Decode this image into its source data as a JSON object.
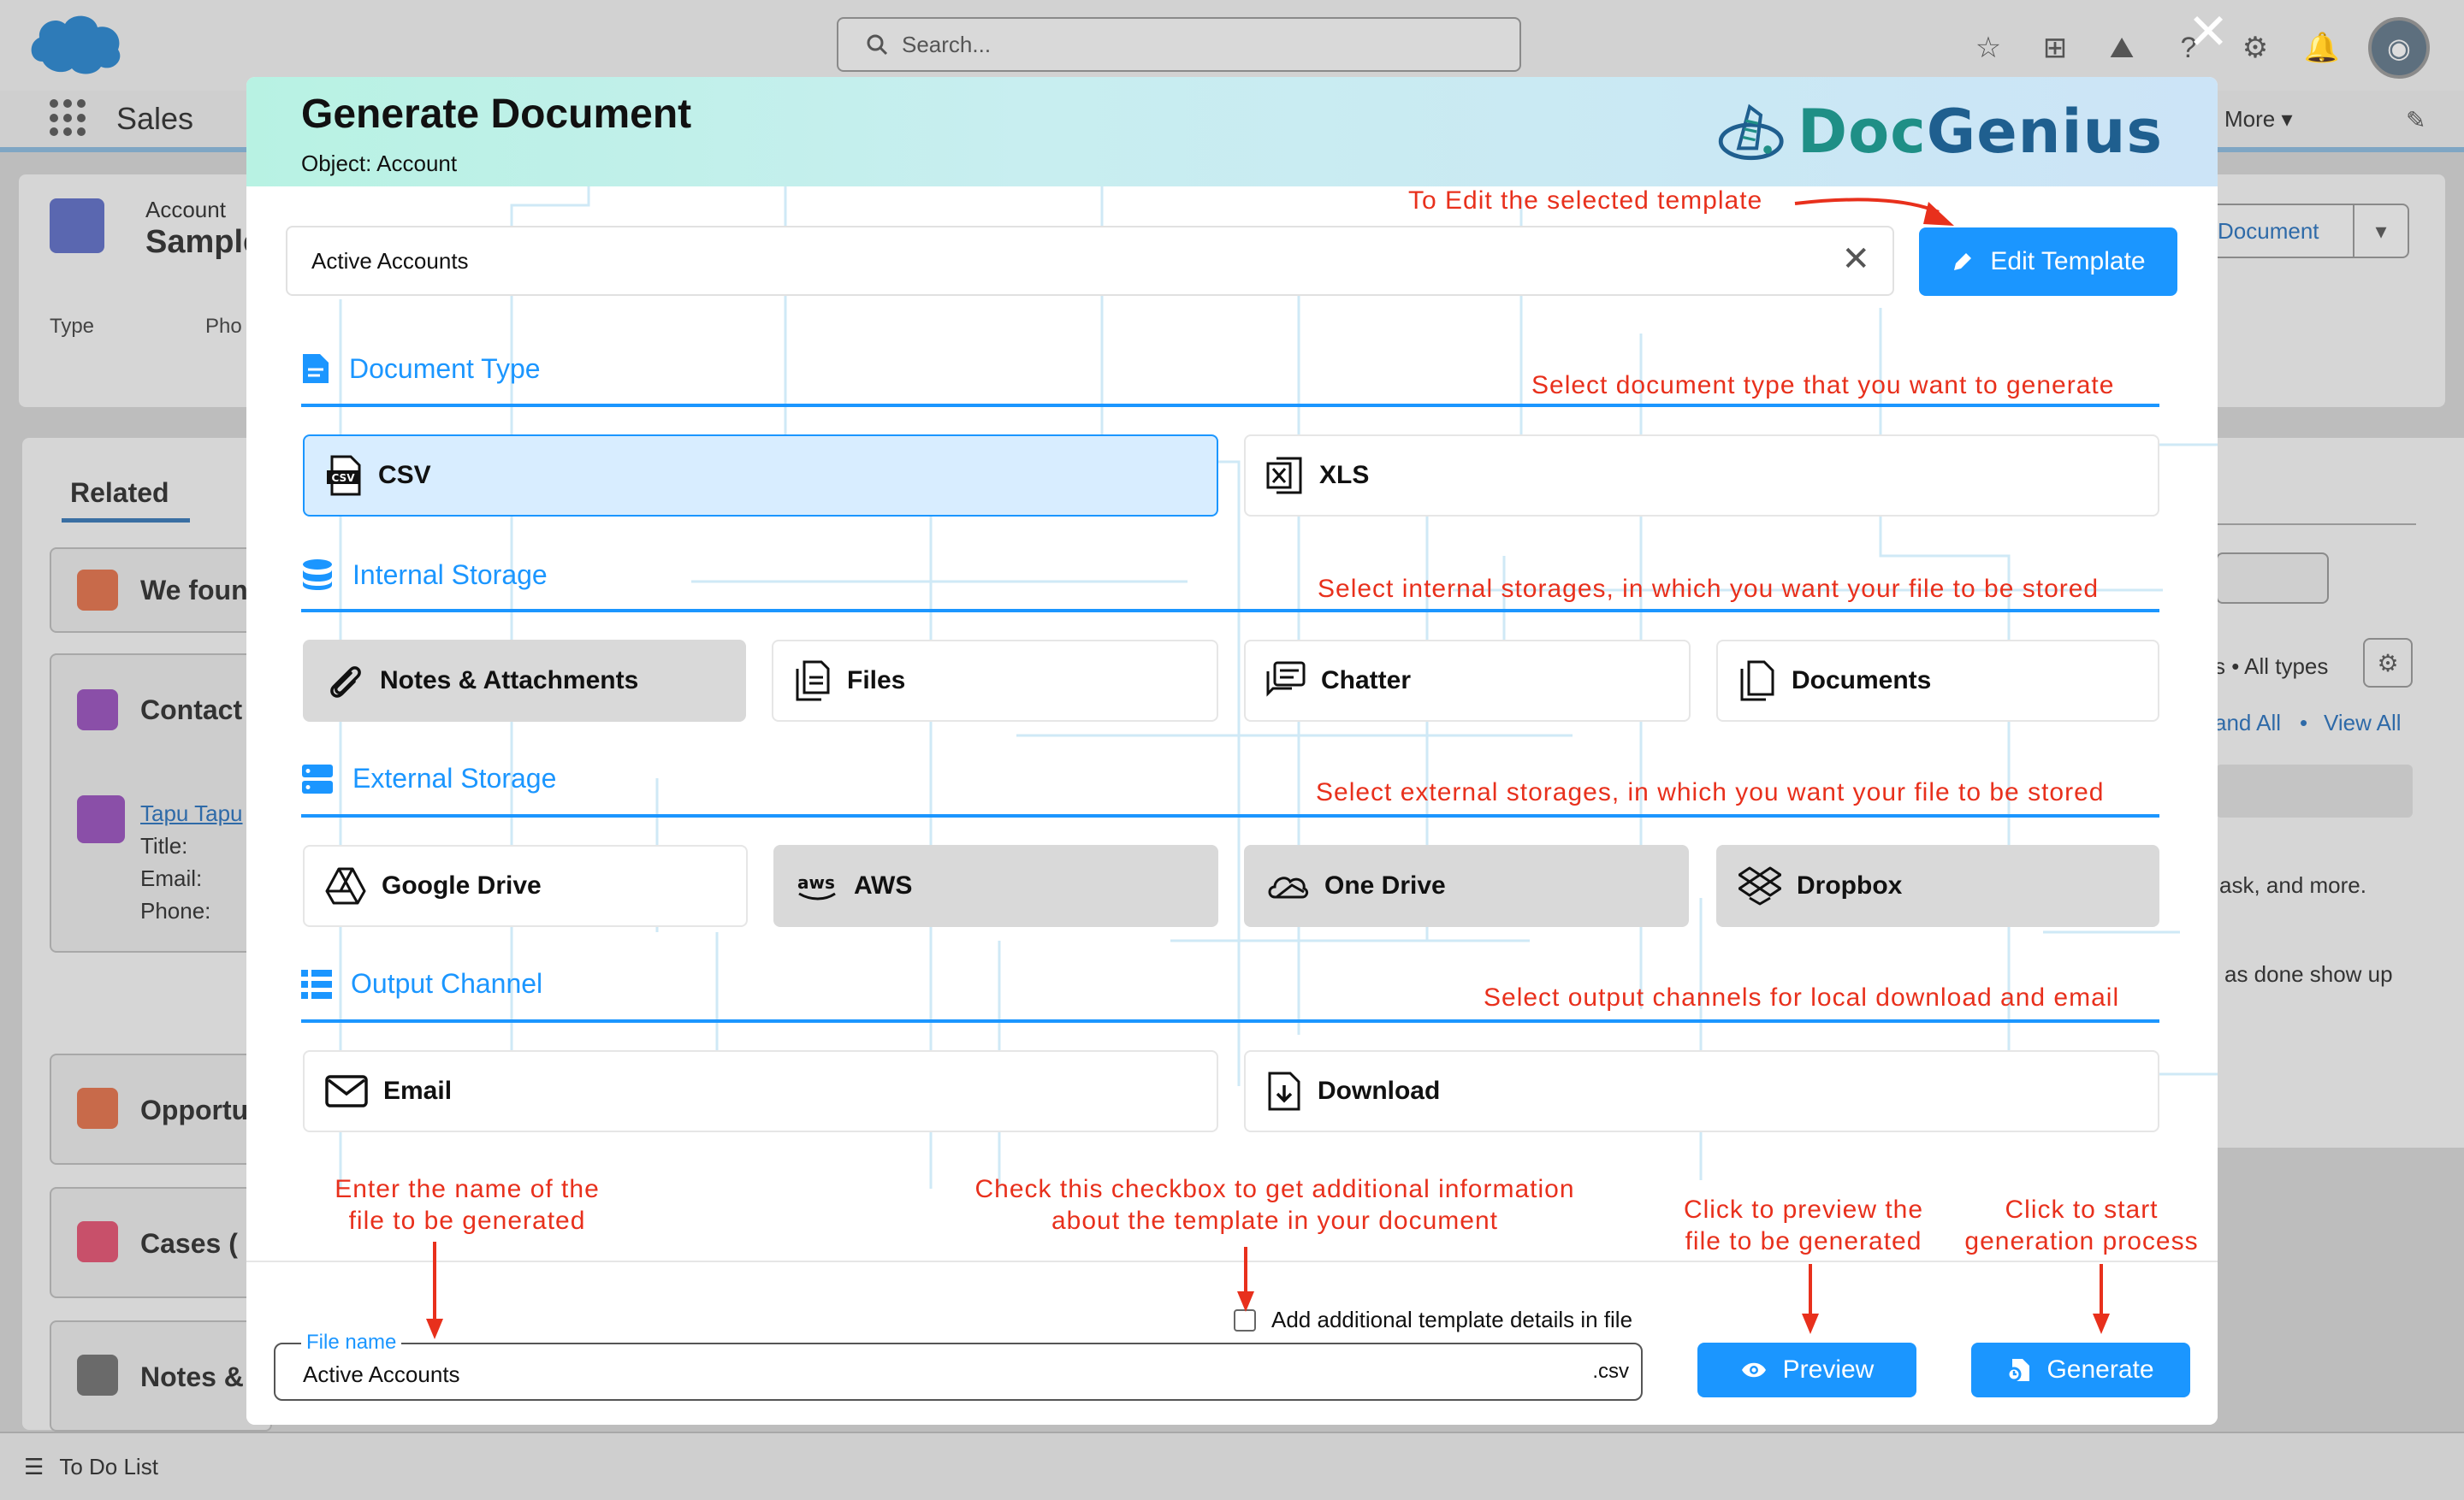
{
  "background": {
    "search_placeholder": "Search...",
    "app_name": "Sales",
    "nav_more": "More",
    "record_object": "Account",
    "record_name": "Sample",
    "field_type": "Type",
    "field_phone": "Pho",
    "record_action_button": "Document",
    "related_tab": "Related",
    "related_cards": [
      {
        "title": "We foun"
      },
      {
        "title": "Contact",
        "contact_name": "Tapu Tapu",
        "title_label": "Title:",
        "email_label": "Email:",
        "phone_label": "Phone:"
      },
      {
        "title": "Opportu"
      },
      {
        "title": "Cases ("
      },
      {
        "title": "Notes &"
      }
    ],
    "activity_filter": "s • All types",
    "activity_expand": "and All",
    "activity_separator": "•",
    "activity_view_all": "View All",
    "activity_text_1": "ask, and more.",
    "activity_text_2": "as done show up",
    "todo_bar": "To Do List"
  },
  "modal": {
    "title": "Generate Document",
    "subtitle": "Object: Account",
    "brand": {
      "part1": "Doc",
      "part2": "Genius"
    },
    "template_value": "Active Accounts",
    "edit_template_label": "Edit Template",
    "sections": {
      "document_type": {
        "heading": "Document Type",
        "options": [
          {
            "label": "CSV",
            "icon": "csv-file-icon",
            "selected": true
          },
          {
            "label": "XLS",
            "icon": "excel-file-icon",
            "selected": false
          }
        ]
      },
      "internal_storage": {
        "heading": "Internal Storage",
        "options": [
          {
            "label": "Notes & Attachments",
            "icon": "paperclip-icon",
            "disabled": true
          },
          {
            "label": "Files",
            "icon": "files-icon",
            "disabled": false
          },
          {
            "label": "Chatter",
            "icon": "chatter-icon",
            "disabled": false
          },
          {
            "label": "Documents",
            "icon": "documents-icon",
            "disabled": false
          }
        ]
      },
      "external_storage": {
        "heading": "External Storage",
        "options": [
          {
            "label": "Google Drive",
            "icon": "google-drive-icon",
            "disabled": false
          },
          {
            "label": "AWS",
            "icon": "aws-icon",
            "disabled": true
          },
          {
            "label": "One Drive",
            "icon": "onedrive-icon",
            "disabled": true
          },
          {
            "label": "Dropbox",
            "icon": "dropbox-icon",
            "disabled": true
          }
        ]
      },
      "output_channel": {
        "heading": "Output Channel",
        "options": [
          {
            "label": "Email",
            "icon": "email-icon"
          },
          {
            "label": "Download",
            "icon": "download-icon"
          }
        ]
      }
    },
    "footer": {
      "checkbox_label": "Add additional template details in file",
      "checkbox_checked": false,
      "file_name_label": "File name",
      "file_name_value": "Active Accounts",
      "file_extension": ".csv",
      "preview_label": "Preview",
      "generate_label": "Generate"
    }
  },
  "annotations": {
    "edit_template": "To Edit the selected template",
    "document_type": "Select document type that you want to generate",
    "internal_storage": "Select internal storages, in which you want your file to be stored",
    "external_storage": "Select external storages, in which you want your file to be stored",
    "output_channel": "Select output channels for local download and email",
    "file_name_line1": "Enter the name of the",
    "file_name_line2": "file to be generated",
    "checkbox_line1": "Check this checkbox to get additional information",
    "checkbox_line2": "about the template in your document",
    "preview_line1": "Click to preview the",
    "preview_line2": "file to be generated",
    "generate_line1": "Click to start",
    "generate_line2": "generation process"
  },
  "colors": {
    "accent": "#1b96ff",
    "annotation": "#e8301c",
    "selected_bg": "#d8edff",
    "disabled_bg": "#d9d9d9"
  }
}
